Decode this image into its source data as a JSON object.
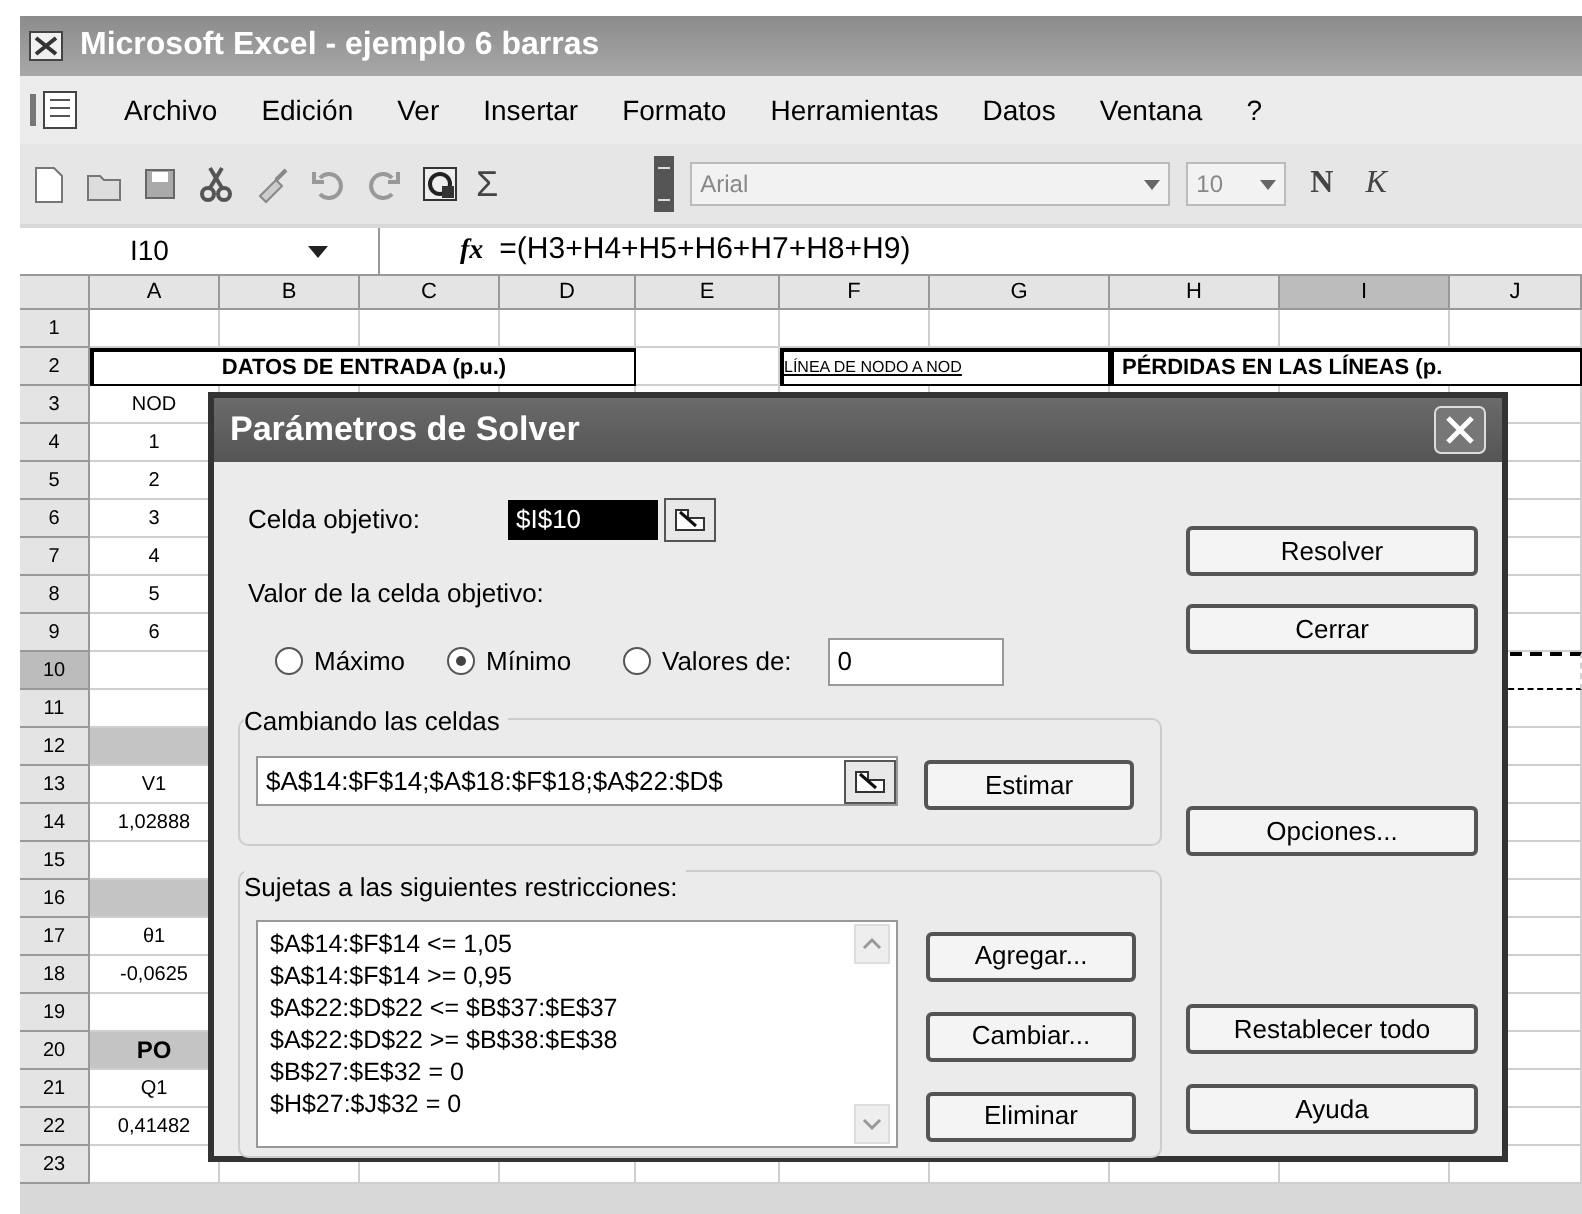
{
  "window": {
    "title": "Microsoft Excel - ejemplo 6 barras"
  },
  "menu": [
    "Archivo",
    "Edición",
    "Ver",
    "Insertar",
    "Formato",
    "Herramientas",
    "Datos",
    "Ventana",
    "?"
  ],
  "toolbar": {
    "autosum": "Σ",
    "font": "Arial",
    "font_size": "10",
    "format_buttons": [
      "N",
      "K"
    ]
  },
  "formula_bar": {
    "name_box": "I10",
    "fx": "fx",
    "formula": "=(H3+H4+H5+H6+H7+H8+H9)"
  },
  "sheet": {
    "columns": [
      {
        "label": "A",
        "selected": false
      },
      {
        "label": "B",
        "selected": false
      },
      {
        "label": "C",
        "selected": false
      },
      {
        "label": "D",
        "selected": false
      },
      {
        "label": "E",
        "selected": false
      },
      {
        "label": "F",
        "selected": false
      },
      {
        "label": "G",
        "selected": false
      },
      {
        "label": "H",
        "selected": false
      },
      {
        "label": "I",
        "selected": true
      },
      {
        "label": "J",
        "selected": false
      }
    ],
    "section_headers": [
      "DATOS DE ENTRADA (p.u.)",
      "LÍNEA DE NODO A NOD",
      "PÉRDIDAS EN LAS LÍNEAS (p."
    ],
    "rows": [
      {
        "label": "1",
        "selected": false,
        "marquee": false
      },
      {
        "label": "2",
        "selected": false,
        "marquee": false
      },
      {
        "label": "3",
        "selected": false,
        "marquee": false,
        "col_a": {
          "text": "NOD",
          "kind": "plain"
        }
      },
      {
        "label": "4",
        "selected": false,
        "marquee": false,
        "col_a": {
          "text": "1",
          "kind": "plain"
        }
      },
      {
        "label": "5",
        "selected": false,
        "marquee": false,
        "col_a": {
          "text": "2",
          "kind": "plain"
        }
      },
      {
        "label": "6",
        "selected": false,
        "marquee": false,
        "col_a": {
          "text": "3",
          "kind": "plain"
        }
      },
      {
        "label": "7",
        "selected": false,
        "marquee": false,
        "col_a": {
          "text": "4",
          "kind": "plain"
        }
      },
      {
        "label": "8",
        "selected": false,
        "marquee": false,
        "col_a": {
          "text": "5",
          "kind": "plain"
        }
      },
      {
        "label": "9",
        "selected": false,
        "marquee": false,
        "col_a": {
          "text": "6",
          "kind": "plain"
        }
      },
      {
        "label": "10",
        "selected": true,
        "marquee": true
      },
      {
        "label": "11",
        "selected": false,
        "marquee": false
      },
      {
        "label": "12",
        "selected": false,
        "marquee": false,
        "col_a": {
          "kind": "shaded"
        }
      },
      {
        "label": "13",
        "selected": false,
        "marquee": false,
        "col_a": {
          "text": "V1",
          "kind": "plain"
        }
      },
      {
        "label": "14",
        "selected": false,
        "marquee": false,
        "col_a": {
          "text": "1,02888",
          "kind": "plain"
        }
      },
      {
        "label": "15",
        "selected": false,
        "marquee": false
      },
      {
        "label": "16",
        "selected": false,
        "marquee": false,
        "col_a": {
          "kind": "shaded"
        }
      },
      {
        "label": "17",
        "selected": false,
        "marquee": false,
        "col_a": {
          "text": "θ1",
          "kind": "plain"
        }
      },
      {
        "label": "18",
        "selected": false,
        "marquee": false,
        "col_a": {
          "text": "-0,0625",
          "kind": "plain"
        }
      },
      {
        "label": "19",
        "selected": false,
        "marquee": false
      },
      {
        "label": "20",
        "selected": false,
        "marquee": false,
        "col_a": {
          "text": "PO",
          "kind": "title"
        }
      },
      {
        "label": "21",
        "selected": false,
        "marquee": false,
        "col_a": {
          "text": "Q1",
          "kind": "plain"
        }
      },
      {
        "label": "22",
        "selected": false,
        "marquee": false,
        "col_a": {
          "text": "0,41482",
          "kind": "plain"
        }
      },
      {
        "label": "23",
        "selected": false,
        "marquee": false
      }
    ]
  },
  "dialog": {
    "title": "Parámetros de Solver",
    "target_label": "Celda objetivo:",
    "target_value": "$I$10",
    "value_label": "Valor de la celda objetivo:",
    "options": [
      {
        "label": "Máximo",
        "selected": false
      },
      {
        "label": "Mínimo",
        "selected": true
      },
      {
        "label": "Valores de:",
        "selected": false
      }
    ],
    "value_field": "0",
    "changing_legend": "Cambiando las celdas",
    "changing_value": "$A$14:$F$14;$A$18:$F$18;$A$22:$D$",
    "guess_button": "Estimar",
    "constraints_legend": "Sujetas a las siguientes restricciones:",
    "constraints": [
      "$A$14:$F$14 <= 1,05",
      "$A$14:$F$14 >= 0,95",
      "$A$22:$D$22 <= $B$37:$E$37",
      "$A$22:$D$22 >= $B$38:$E$38",
      "$B$27:$E$32 = 0",
      "$H$27:$J$32 = 0"
    ],
    "constraint_buttons": [
      "Agregar...",
      "Cambiar...",
      "Eliminar"
    ],
    "side_buttons": [
      "Resolver",
      "Cerrar",
      "Opciones...",
      "Restablecer todo",
      "Ayuda"
    ]
  }
}
